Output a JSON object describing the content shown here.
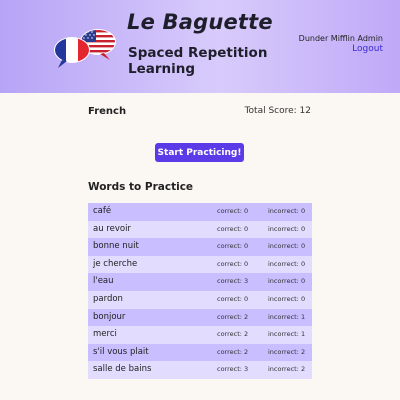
{
  "header": {
    "title": "Le Baguette",
    "subtitle": "Spaced Repetition Learning",
    "user_name": "Dunder Mifflin Admin",
    "logout_label": "Logout",
    "logo_icon": "french-american-flag-speech-bubbles-icon"
  },
  "language": {
    "name": "French",
    "total_score_label": "Total Score: 12"
  },
  "start_button_label": "Start Practicing!",
  "words_section_title": "Words to Practice",
  "words": [
    {
      "word": "café",
      "correct": "correct: 0",
      "incorrect": "incorrect: 0"
    },
    {
      "word": "au revoir",
      "correct": "correct: 0",
      "incorrect": "incorrect: 0"
    },
    {
      "word": "bonne nuit",
      "correct": "correct: 0",
      "incorrect": "incorrect: 0"
    },
    {
      "word": "je cherche",
      "correct": "correct: 0",
      "incorrect": "incorrect: 0"
    },
    {
      "word": "l'eau",
      "correct": "correct: 3",
      "incorrect": "incorrect: 0"
    },
    {
      "word": "pardon",
      "correct": "correct: 0",
      "incorrect": "incorrect: 0"
    },
    {
      "word": "bonjour",
      "correct": "correct: 2",
      "incorrect": "incorrect: 1"
    },
    {
      "word": "merci",
      "correct": "correct: 2",
      "incorrect": "incorrect: 1"
    },
    {
      "word": "s'il vous plait",
      "correct": "correct: 2",
      "incorrect": "incorrect: 2"
    },
    {
      "word": "salle de bains",
      "correct": "correct: 3",
      "incorrect": "incorrect: 2"
    }
  ],
  "colors": {
    "header_gradient_start": "#b7a4f6",
    "header_gradient_end": "#d8cbfb",
    "accent": "#5b3be7",
    "row_dark": "#c9beff",
    "row_light": "#e2dcff",
    "page_bg": "#fbf8f3"
  }
}
